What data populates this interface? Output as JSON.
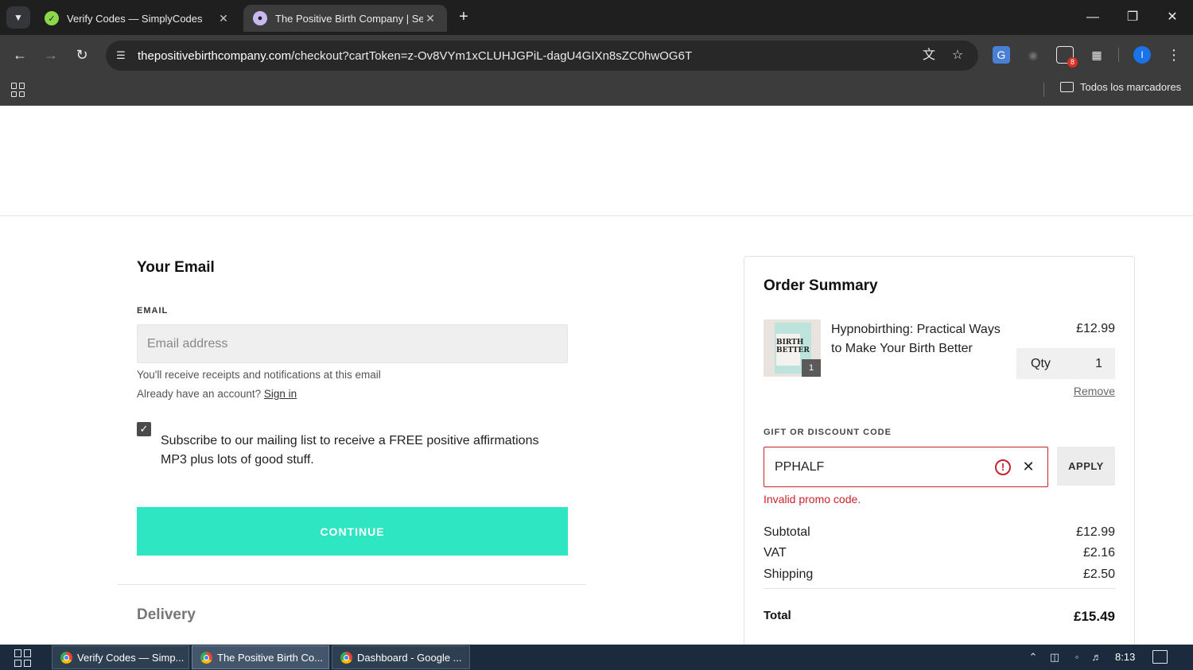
{
  "browser": {
    "tabs": [
      {
        "title": "Verify Codes — SimplyCodes",
        "favicon": "simplycodes-icon",
        "active": false
      },
      {
        "title": "The Positive Birth Company | Se",
        "favicon": "positive-birth-icon",
        "active": true
      }
    ],
    "url_domain": "thepositivebirthcompany.com",
    "url_path": "/checkout?cartToken=z-Ov8VYm1xCLUHJGPiL-dagU4GIXn8sZC0hwOG6T",
    "extension_badge": "8",
    "profile_initial": "I",
    "bookmarks_all": "Todos los marcadores"
  },
  "email_section": {
    "title": "Your Email",
    "label": "EMAIL",
    "placeholder": "Email address",
    "value": "",
    "hint_receipts": "You'll receive receipts and notifications at this email",
    "hint_account": "Already have an account?",
    "sign_in": "Sign in",
    "subscribe_checked": true,
    "subscribe_text": "Subscribe to our mailing list to receive a FREE positive affirmations MP3 plus lots of good stuff.",
    "continue": "CONTINUE"
  },
  "delivery_section": {
    "title": "Delivery"
  },
  "summary": {
    "title": "Order Summary",
    "product": {
      "name": "Hypnobirthing: Practical Ways to Make Your Birth Better",
      "price": "£12.99",
      "qty_label": "Qty",
      "qty": "1",
      "badge": "1",
      "cover_text": "BIRTH BETTER",
      "remove": "Remove"
    },
    "discount_label": "GIFT OR DISCOUNT CODE",
    "discount_code": "PPHALF",
    "apply": "APPLY",
    "error": "Invalid promo code.",
    "subtotal_label": "Subtotal",
    "subtotal": "£12.99",
    "vat_label": "VAT",
    "vat": "£2.16",
    "shipping_label": "Shipping",
    "shipping": "£2.50",
    "total_label": "Total",
    "total": "£15.49"
  },
  "taskbar": {
    "items": [
      {
        "label": "Verify Codes — Simp...",
        "active": false
      },
      {
        "label": "The Positive Birth Co...",
        "active": true
      },
      {
        "label": "Dashboard - Google ...",
        "active": false
      }
    ],
    "time": "8:13"
  },
  "colors": {
    "accent_teal": "#2ee6c1",
    "error_red": "#c8232c",
    "chrome_dark": "#3c3c3c"
  }
}
